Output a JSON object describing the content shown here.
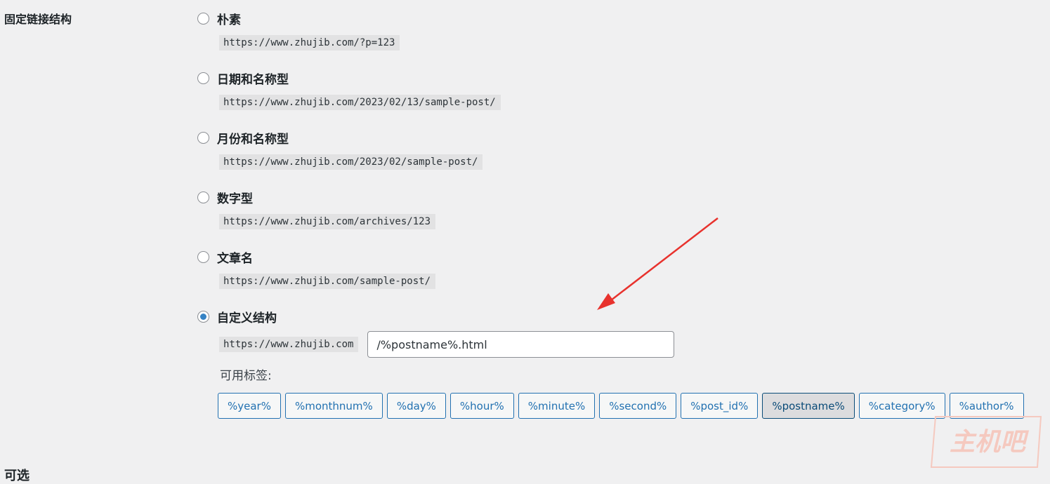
{
  "section_title": "固定链接结构",
  "next_section_title": "可选",
  "options": [
    {
      "label": "朴素",
      "url": "https://www.zhujib.com/?p=123",
      "checked": false
    },
    {
      "label": "日期和名称型",
      "url": "https://www.zhujib.com/2023/02/13/sample-post/",
      "checked": false
    },
    {
      "label": "月份和名称型",
      "url": "https://www.zhujib.com/2023/02/sample-post/",
      "checked": false
    },
    {
      "label": "数字型",
      "url": "https://www.zhujib.com/archives/123",
      "checked": false
    },
    {
      "label": "文章名",
      "url": "https://www.zhujib.com/sample-post/",
      "checked": false
    }
  ],
  "custom": {
    "label": "自定义结构",
    "checked": true,
    "base_url": "https://www.zhujib.com",
    "value": "/%postname%.html"
  },
  "tags_label": "可用标签:",
  "tags": [
    "%year%",
    "%monthnum%",
    "%day%",
    "%hour%",
    "%minute%",
    "%second%",
    "%post_id%",
    "%postname%",
    "%category%",
    "%author%"
  ],
  "active_tag": "%postname%",
  "watermark": "主机吧",
  "colors": {
    "accent": "#2271b1",
    "radio_checked": "#3582c4",
    "arrow": "#e8322d",
    "watermark": "#f5c9bf"
  }
}
